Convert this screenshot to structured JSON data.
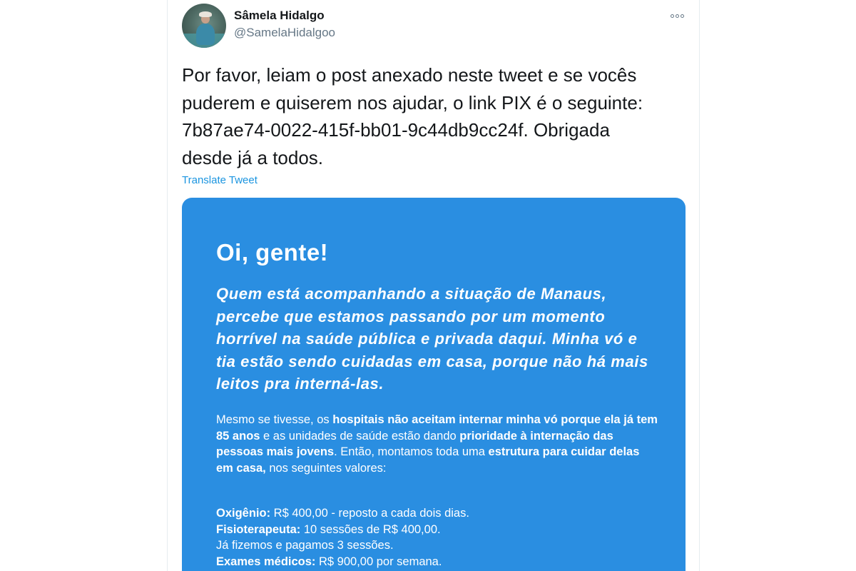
{
  "tweet": {
    "author": {
      "display_name": "Sâmela Hidalgo",
      "handle": "@SamelaHidalgoo"
    },
    "more_icon": "more-options-icon",
    "text": "Por favor, leiam o post anexado neste tweet e se vocês\npuderem e quiserem nos ajudar, o link PIX é o seguinte:\n7b87ae74-0022-415f-bb01-9c44db9cc24f. Obrigada\ndesde já a todos.",
    "translate_label": "Translate Tweet"
  },
  "image": {
    "background_color": "#2a8ee1",
    "title": "Oi, gente!",
    "lead": "Quem está acompanhando a situação de Manaus, percebe que estamos passando por um momento horrível na saúde pública e privada daqui. Minha vó e tia estão sendo cuidadas em casa, porque não há mais leitos pra interná-las.",
    "body": {
      "p1": "Mesmo se tivesse, os ",
      "b1": "hospitais não aceitam internar minha vó porque ela já tem 85 anos",
      "p2": " e as unidades de saúde estão dando ",
      "b2": "prioridade à internação das pessoas mais jovens",
      "p3": ". Então, montamos toda uma ",
      "b3": "estrutura para cuidar delas em casa,",
      "p4": " nos seguintes valores:"
    },
    "costs": [
      {
        "label": "Oxigênio:",
        "value": " R$ 400,00 - reposto a cada dois dias."
      },
      {
        "label": "Fisioterapeuta:",
        "value": " 10 sessões de R$ 400,00."
      },
      {
        "label": "",
        "value": "Já fizemos e pagamos 3 sessões."
      },
      {
        "label": "Exames médicos:",
        "value": " R$ 900,00 por semana."
      }
    ]
  },
  "colors": {
    "text_primary": "#14171a",
    "text_secondary": "#657786",
    "link": "#1b95e0"
  }
}
